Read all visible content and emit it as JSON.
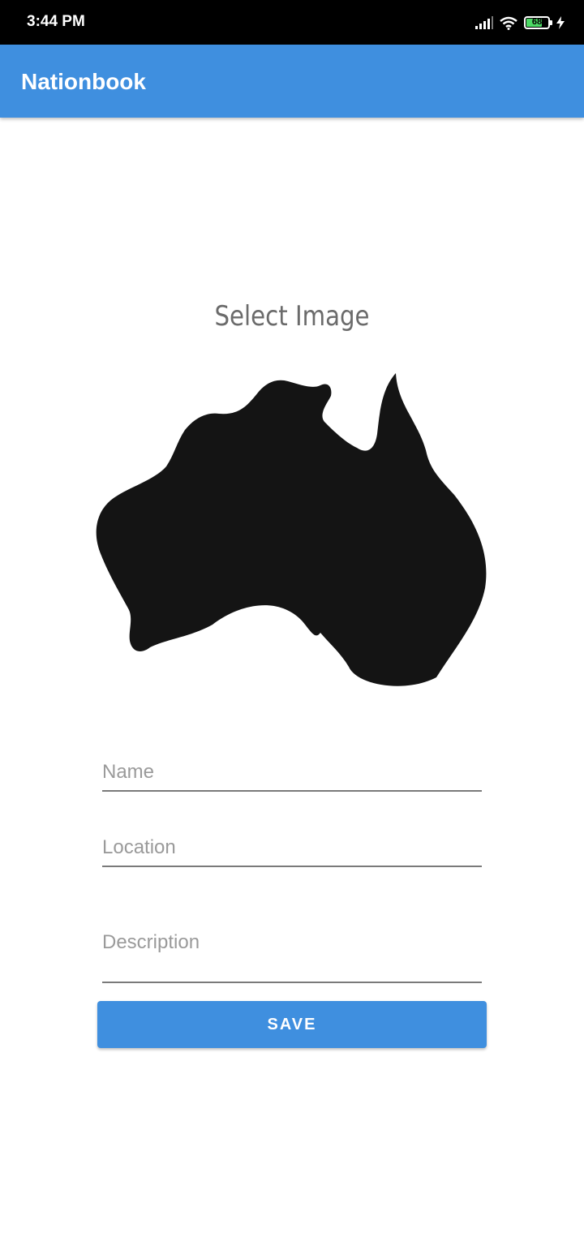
{
  "status_bar": {
    "time": "3:44 PM",
    "battery_level": "68",
    "icons": [
      "signal-icon",
      "wifi-icon",
      "battery-icon",
      "charging-icon"
    ]
  },
  "app_bar": {
    "title": "Nationbook",
    "color": "#3f8fdf"
  },
  "image_picker": {
    "label": "Select Image",
    "image": "australia-map-silhouette"
  },
  "form": {
    "name_placeholder": "Name",
    "name_value": "",
    "location_placeholder": "Location",
    "location_value": "",
    "description_placeholder": "Description",
    "description_value": ""
  },
  "actions": {
    "save_label": "SAVE"
  }
}
